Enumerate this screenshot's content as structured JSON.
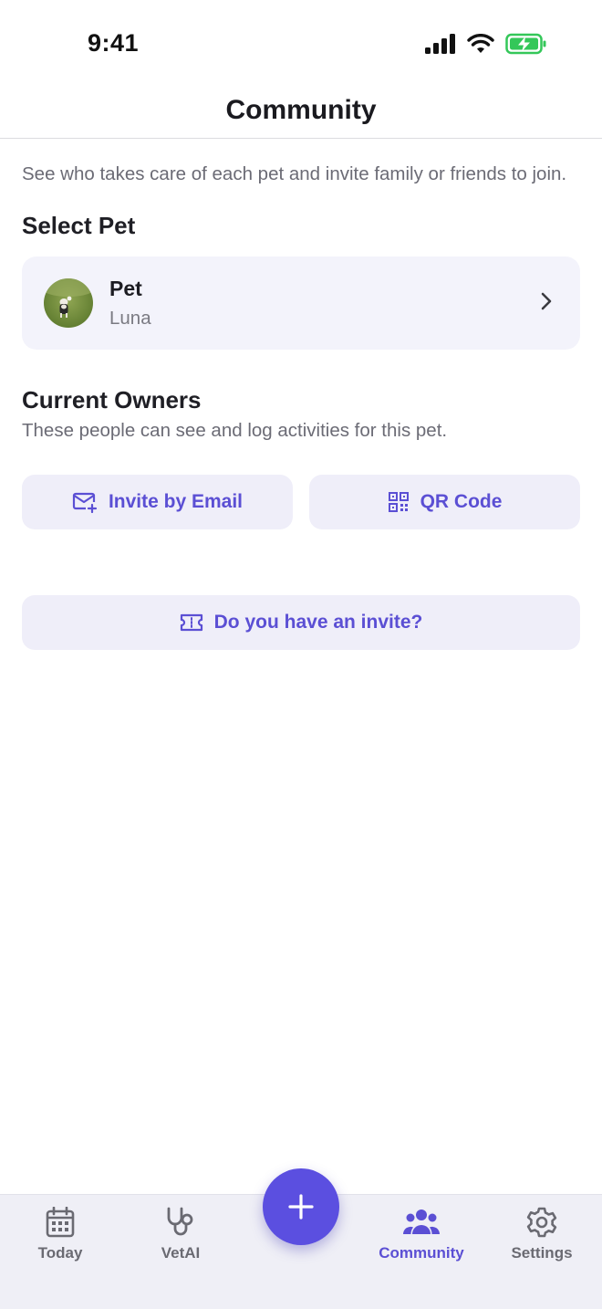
{
  "status_bar": {
    "time": "9:41"
  },
  "header": {
    "title": "Community"
  },
  "intro": "See who takes care of each pet and invite family or friends to join.",
  "select_pet": {
    "title": "Select Pet",
    "card_label": "Pet",
    "pet_name": "Luna"
  },
  "owners": {
    "title": "Current Owners",
    "subtitle": "These people can see and log activities for this pet."
  },
  "actions": {
    "invite_email": "Invite by Email",
    "qr_code": "QR Code",
    "have_invite": "Do you have an invite?"
  },
  "tabs": [
    {
      "label": "Today",
      "icon": "calendar-icon"
    },
    {
      "label": "VetAI",
      "icon": "stethoscope-icon"
    },
    {
      "label": "Community",
      "icon": "people-icon"
    },
    {
      "label": "Settings",
      "icon": "gear-icon"
    }
  ],
  "colors": {
    "accent": "#5b4fd4",
    "button_bg": "#efeef9",
    "card_bg": "#f3f3fb",
    "battery": "#34c759"
  }
}
